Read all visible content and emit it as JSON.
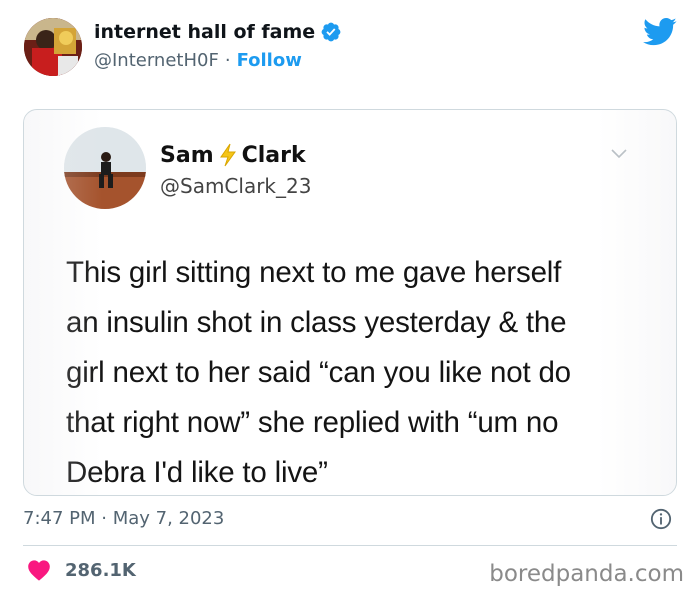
{
  "author": {
    "display_name": "internet hall of fame",
    "handle": "@InternetH0F",
    "separator": "·",
    "follow_label": "Follow",
    "verified": true
  },
  "embedded_tweet": {
    "name_first": "Sam",
    "name_last": "Clark",
    "handle": "@SamClark_23",
    "text_lines": [
      "This girl sitting next to me gave herself",
      "an insulin shot in class yesterday & the",
      "girl next to her said “can you like not do",
      "that right now” she replied with “um no",
      "Debra I'd like to live”"
    ]
  },
  "footer": {
    "timestamp": "7:47 PM · May 7, 2023",
    "likes": "286.1K",
    "watermark": "boredpanda.com"
  },
  "colors": {
    "accent": "#1d9bf0",
    "heart": "#f91880",
    "muted": "#536471"
  },
  "icons": [
    "verified-badge-icon",
    "twitter-bird-icon",
    "lightning-bolt-icon",
    "chevron-down-icon",
    "info-icon",
    "heart-icon"
  ]
}
